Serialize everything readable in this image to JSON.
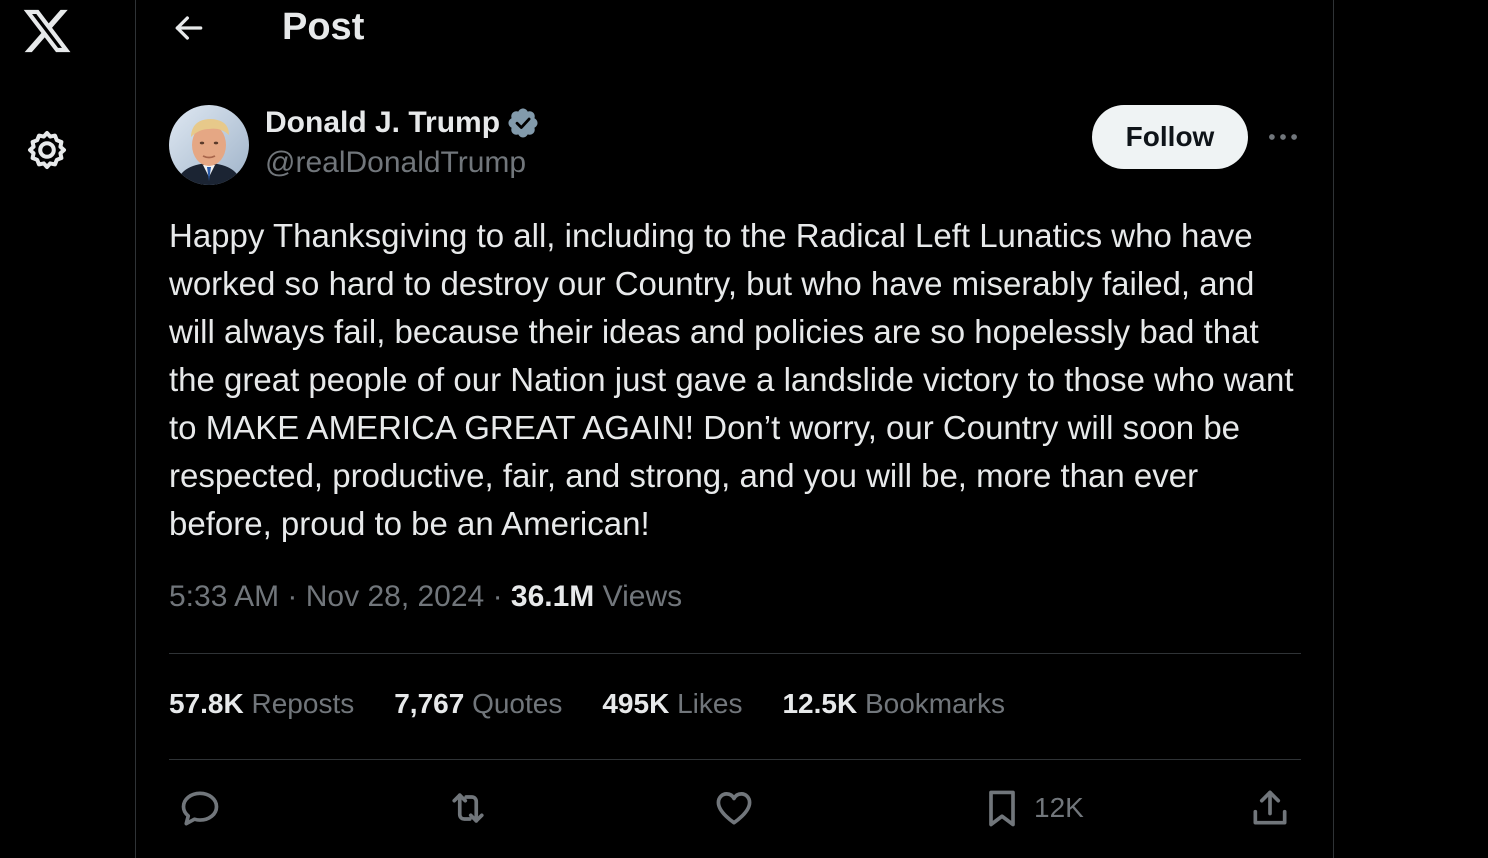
{
  "header": {
    "title": "Post"
  },
  "post": {
    "author": {
      "name": "Donald J. Trump",
      "handle": "@realDonaldTrump",
      "verified": true
    },
    "follow_label": "Follow",
    "text": "Happy Thanksgiving to all, including to the Radical Left Lunatics who have worked so hard to destroy our Country, but who have miserably failed, and will always fail, because their ideas and policies are so hopelessly bad that the great people of our Nation just gave a landslide victory to those who want to MAKE AMERICA GREAT AGAIN! Don’t worry, our Country will soon be respected, productive, fair, and strong, and you will be, more than ever before, proud to be an American!",
    "time": "5:33 AM",
    "separator": "·",
    "date": "Nov 28, 2024",
    "views_count": "36.1M",
    "views_label": "Views"
  },
  "stats": [
    {
      "value": "57.8K",
      "label": "Reposts"
    },
    {
      "value": "7,767",
      "label": "Quotes"
    },
    {
      "value": "495K",
      "label": "Likes"
    },
    {
      "value": "12.5K",
      "label": "Bookmarks"
    }
  ],
  "actions": {
    "bookmark_count": "12K"
  },
  "icons": {
    "logo": "x-logo-icon",
    "settings": "gear-icon",
    "back": "arrow-left-icon",
    "more": "more-horizontal-icon",
    "reply": "reply-icon",
    "repost": "repost-icon",
    "like": "heart-icon",
    "bookmark": "bookmark-icon",
    "share": "share-icon"
  },
  "colors": {
    "background": "#000000",
    "text": "#e7e9ea",
    "secondary": "#71767b",
    "border": "#2f3336",
    "verified": "#829aab",
    "follow_bg": "#eff3f4"
  }
}
